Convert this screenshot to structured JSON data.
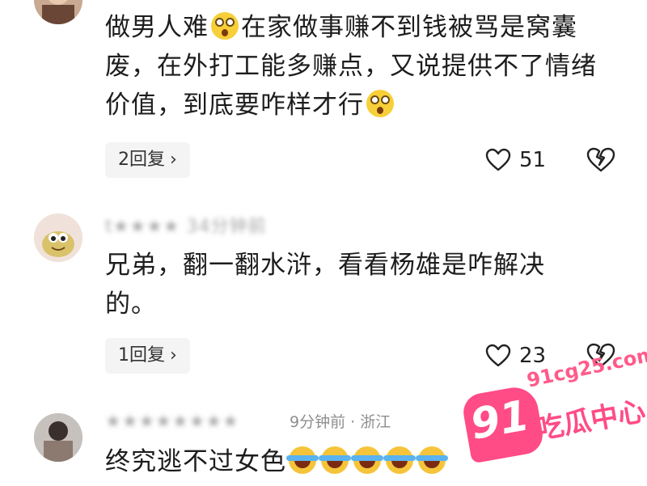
{
  "comments": [
    {
      "text_segments": [
        "做男人难",
        "在家做事赚不到钱被骂是窝囊废，在外打工能多赚点，又说提供不了情绪价值，到底要咋样才行"
      ],
      "reply_label": "2回复",
      "likes": "51"
    },
    {
      "username": "t★★★★ 34分钟前",
      "text": "兄弟，翻一翻水浒，看看杨雄是咋解决的。",
      "reply_label": "1回复",
      "likes": "23"
    },
    {
      "username": "★★★★★★★★",
      "meta": "9分钟前 · 浙江",
      "text": "终究逃不过女色"
    }
  ],
  "icons": {
    "reply_chevron": "chevron-right-icon",
    "like": "heart-outline-icon",
    "dislike": "broken-heart-icon",
    "emoji_shock": "shocked-emoji",
    "emoji_laugh": "laughing-crying-emoji"
  },
  "watermark": {
    "url": "91cg25.com",
    "number": "91",
    "name": "吃瓜中心",
    "color": "#ff4b86"
  },
  "colors": {
    "text": "#1d1d1d",
    "meta": "#8e8e8e",
    "pill_bg": "#f4f4f4"
  }
}
